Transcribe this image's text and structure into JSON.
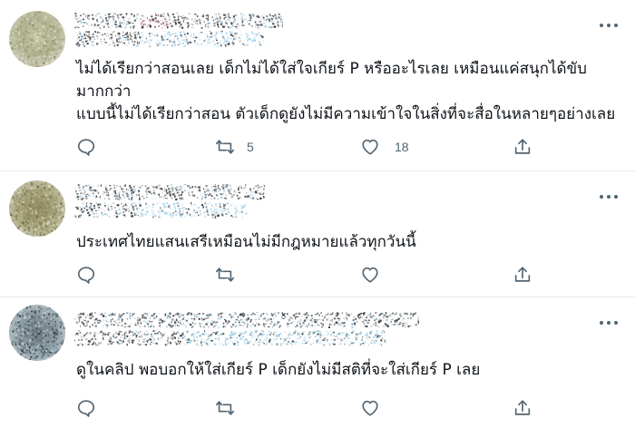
{
  "colors": {
    "icon": "#536471",
    "divider": "#e6ecf0",
    "text": "#0f1419",
    "blur_dark": "#222222",
    "blur_blue": "#8ec8e8",
    "blur_red": "#8a2a3a"
  },
  "tweets": [
    {
      "text": "ไม่ได้เรียกว่าสอนเลย เด็กไม่ได้ใส่ใจเกียร์ P หรืออะไรเลย เหมือนแค่สนุกได้ขับ\nมากกว่า\nแบบนี้ไม่ได้เรียกว่าสอน ตัวเด็กดูยังไม่มีความเข้าใจในสิ่งที่จะสื่อในหลายๆอย่างเลย",
      "reply_count": "",
      "retweet_count": "5",
      "like_count": "18",
      "icons": [
        "reply-icon",
        "retweet-icon",
        "like-icon",
        "share-icon"
      ]
    },
    {
      "text": "ประเทศไทยแสนเสรีเหมือนไม่มีกฎหมายแล้วทุกวันนี้",
      "reply_count": "",
      "retweet_count": "",
      "like_count": "",
      "icons": [
        "reply-icon",
        "retweet-icon",
        "like-icon",
        "share-icon"
      ]
    },
    {
      "text": "ดูในคลิป พอบอกให้ใส่เกียร์ P เด็กยังไม่มีสติที่จะใส่เกียร์ P เลย",
      "reply_count": "",
      "retweet_count": "",
      "like_count": "",
      "icons": [
        "reply-icon",
        "retweet-icon",
        "like-icon",
        "share-icon"
      ]
    }
  ]
}
